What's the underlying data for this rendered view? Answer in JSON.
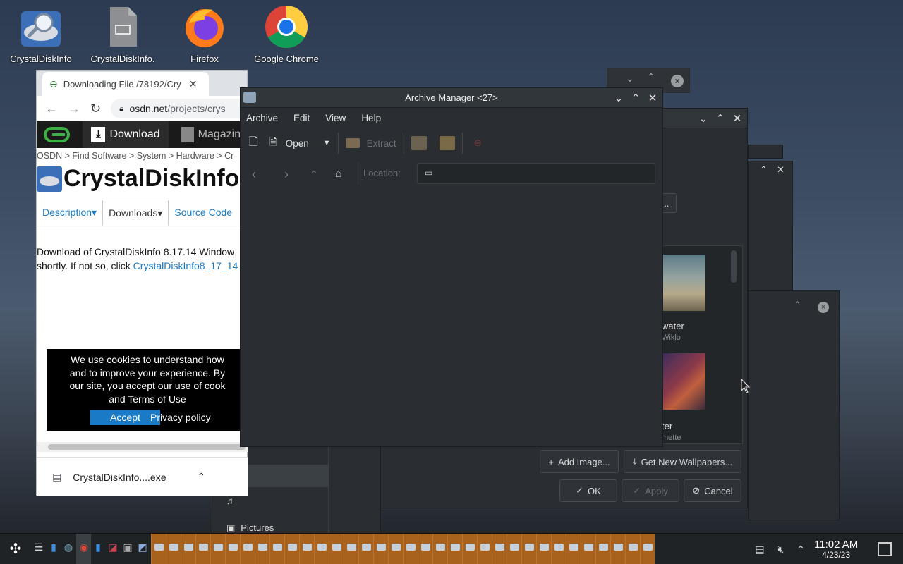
{
  "desktop": {
    "icons": [
      {
        "label": "CrystalDiskInfo",
        "icon": "crystaldiskinfo-icon"
      },
      {
        "label": "CrystalDiskInfo.",
        "icon": "link-file-icon"
      },
      {
        "label": "Firefox",
        "icon": "firefox-icon"
      },
      {
        "label": "Google Chrome",
        "icon": "chrome-icon"
      }
    ]
  },
  "chrome": {
    "tab_title": "Downloading File /78192/Cry",
    "url_domain": "osdn.net",
    "url_path": "/projects/crys",
    "site_nav": {
      "download": "Download",
      "magazine": "Magazine"
    },
    "breadcrumb": "OSDN > Find Software > System > Hardware > Cr",
    "project_title": "CrystalDiskInfo",
    "tabs": [
      "Description",
      "Downloads",
      "Source Code"
    ],
    "download_text_1": "Download of CrystalDiskInfo 8.17.14 Window",
    "download_text_2": "shortly. If not so, click ",
    "download_link": "CrystalDiskInfo8_17_14",
    "cookie": {
      "line1": "We use cookies to understand how",
      "line2": "and to improve your experience. By",
      "line3": "our site, you accept our use of cook",
      "line4": "and Terms of Use",
      "accept": "Accept",
      "privacy": "Privacy policy"
    },
    "download_item": "CrystalDiskInfo....exe"
  },
  "ark": {
    "title": "Archive Manager <27>",
    "menu": [
      "Archive",
      "Edit",
      "View",
      "Help"
    ],
    "toolbar": {
      "open": "Open",
      "extract": "Extract"
    },
    "location_label": "Location:"
  },
  "wallpaper_dialog": {
    "items": [
      {
        "name": "water",
        "author": "Wiklo"
      },
      {
        "name": "ter",
        "author": "mette"
      }
    ],
    "add_image": "Add Image...",
    "get_new": "Get New Wallpapers...",
    "ok": "OK",
    "apply": "Apply",
    "cancel": "Cancel",
    "browse_button": "..."
  },
  "file_dialog": {
    "pictures": "Pictures"
  },
  "taskbar": {
    "time": "11:02 AM",
    "date": "4/23/23"
  },
  "colors": {
    "accent_blue": "#1a7ac6",
    "ark_taskbar": "#a8621e",
    "dark_window": "#2a2e32"
  }
}
